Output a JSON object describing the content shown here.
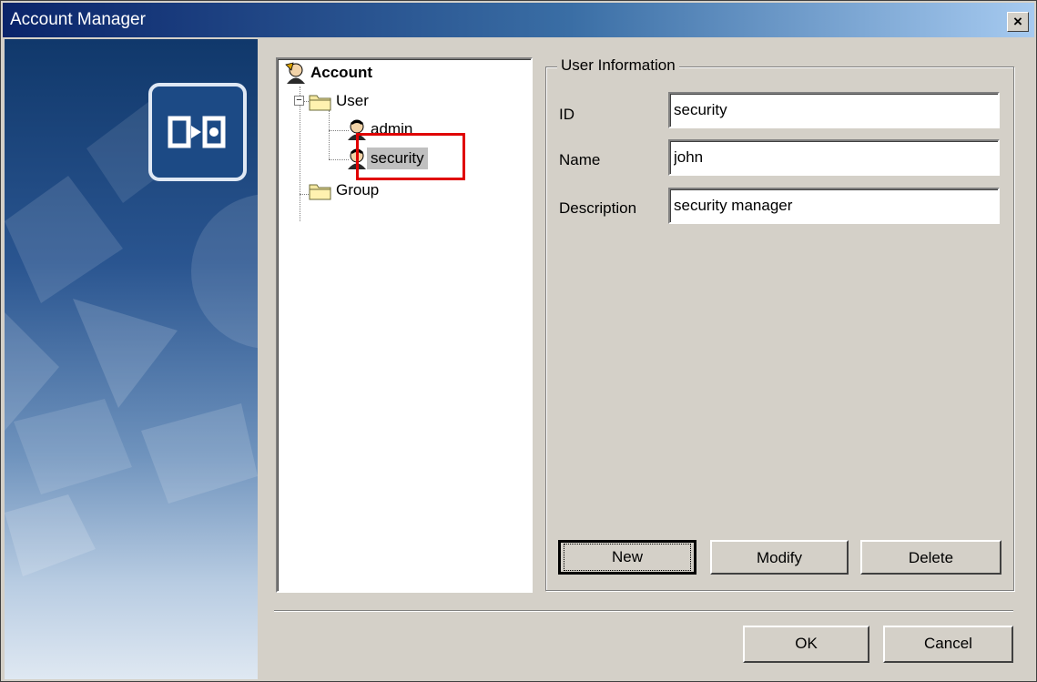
{
  "window": {
    "title": "Account Manager",
    "close_label": "×"
  },
  "tree": {
    "root": {
      "label": "Account",
      "icon": "account-icon"
    },
    "expander_symbol": "−",
    "user_folder": {
      "label": "User",
      "icon": "folder-icon"
    },
    "users": [
      {
        "label": "admin",
        "icon": "user-icon"
      },
      {
        "label": "security",
        "icon": "user-icon",
        "selected": true
      }
    ],
    "group_folder": {
      "label": "Group",
      "icon": "folder-icon"
    }
  },
  "user_info": {
    "title": "User Information",
    "id_label": "ID",
    "id_value": "security",
    "name_label": "Name",
    "name_value": "john",
    "description_label": "Description",
    "description_value": "security manager",
    "new_label": "New",
    "modify_label": "Modify",
    "delete_label": "Delete"
  },
  "footer": {
    "ok_label": "OK",
    "cancel_label": "Cancel"
  },
  "colors": {
    "title_start": "#0a246a",
    "title_end": "#a6caf0",
    "highlight": "#e00000",
    "face": "#d4d0c8"
  }
}
